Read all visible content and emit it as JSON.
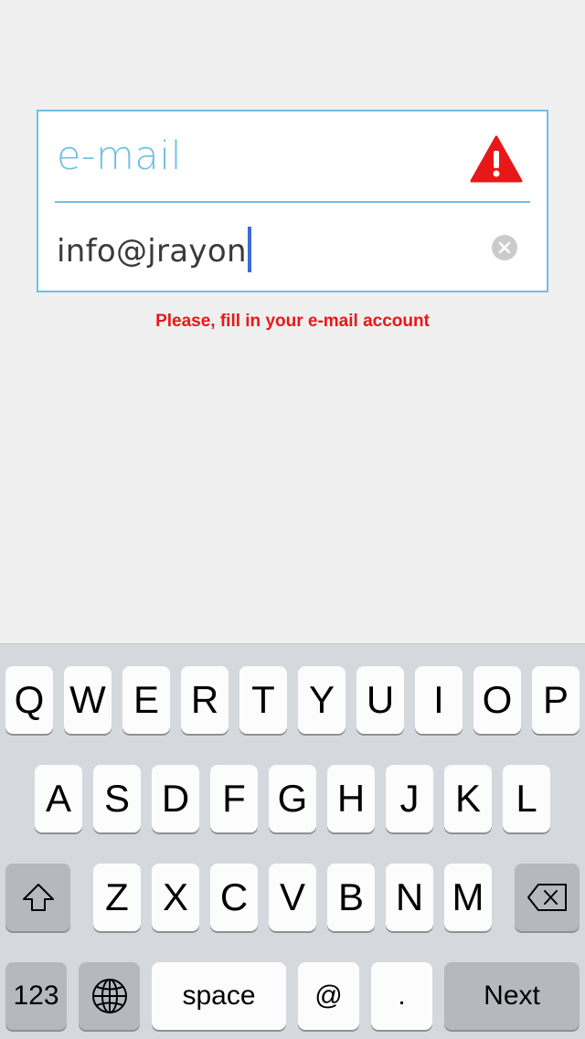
{
  "form": {
    "field_title": "e-mail",
    "input_value": "info@jrayon",
    "error_message": "Please, fill in your e-mail account",
    "accent_color": "#6cc1e6",
    "error_color": "#e81818"
  },
  "keyboard": {
    "row1": [
      "Q",
      "W",
      "E",
      "R",
      "T",
      "Y",
      "U",
      "I",
      "O",
      "P"
    ],
    "row2": [
      "A",
      "S",
      "D",
      "F",
      "G",
      "H",
      "J",
      "K",
      "L"
    ],
    "row3": [
      "Z",
      "X",
      "C",
      "V",
      "B",
      "N",
      "M"
    ],
    "shift_icon": "shift-icon",
    "backspace_icon": "backspace-icon",
    "numbers_label": "123",
    "globe_icon": "globe-icon",
    "space_label": "space",
    "at_label": "@",
    "period_label": ".",
    "next_label": "Next"
  }
}
